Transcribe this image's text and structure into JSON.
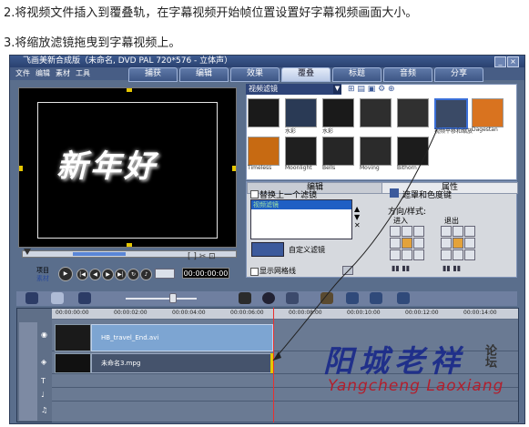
{
  "instructions": {
    "step2": "2.将视频文件插入到覆叠轨，在字幕视频开始帧位置设置好字幕视频画面大小。",
    "step3": "3.将缩放滤镜拖曳到字幕视频上。"
  },
  "window": {
    "title": "飞画美新合成版（未命名, DVD PAL 720*576 - 立体声）",
    "menu": [
      "文件",
      "编辑",
      "素材",
      "工具"
    ],
    "steps": [
      "捕获",
      "编辑",
      "效果",
      "覆叠",
      "标题",
      "音频",
      "分享"
    ],
    "active_step": "覆叠"
  },
  "preview": {
    "text": "新年好",
    "project_label": "项目",
    "clip_label": "素材",
    "timecode": "00:00:00:00"
  },
  "filters": {
    "dropdown": "视频滤镜",
    "thumbnails": [
      {
        "label": "",
        "color": "#1a1a1a"
      },
      {
        "label": "水彩",
        "color": "#2a3a55"
      },
      {
        "label": "水彩",
        "color": "#1a1a1a"
      },
      {
        "label": "",
        "color": "#2e2e2e"
      },
      {
        "label": "",
        "color": "#303030"
      },
      {
        "label": "视频平移和缩放",
        "color": "#3a4a66"
      },
      {
        "label": "Dagestan",
        "color": "#d9731f"
      },
      {
        "label": "Timeless",
        "color": "#c76a12"
      },
      {
        "label": "Moonlight",
        "color": "#1f1f1f"
      },
      {
        "label": "Bells",
        "color": "#262626"
      },
      {
        "label": "Moving",
        "color": "#2b2b2b"
      },
      {
        "label": "Bithorn",
        "color": "#1c1c1c"
      }
    ]
  },
  "attributes": {
    "tab_edit": "编辑",
    "tab_attr": "属性",
    "replace_filter": "替换上一个滤镜",
    "filter_list_item": "视频滤镜",
    "custom_filter": "自定义滤镜",
    "show_grid": "显示网格线",
    "mask_chroma": "遮罩和色度键",
    "direction_style": "方向/样式:",
    "enter": "进入",
    "exit": "退出"
  },
  "timeline": {
    "ticks": [
      "00:00:00:00",
      "00:00:02:00",
      "00:00:04:00",
      "00:00:06:00",
      "00:00:08:00",
      "00:00:10:00",
      "00:00:12:00",
      "00:00:14:00"
    ],
    "clip_video": "HB_travel_End.avi",
    "clip_overlay": "未命名3.mpg"
  },
  "watermark": {
    "main": "阳城老祥",
    "pinyin": "Yangcheng Laoxiang",
    "side": "论坛"
  },
  "colors": {
    "window_bg": "#5a6e8c",
    "title_bar": "#2a4170",
    "accent": "#e5c600",
    "watermark_blue": "#1a2a8a",
    "watermark_red": "#b21f2d"
  }
}
